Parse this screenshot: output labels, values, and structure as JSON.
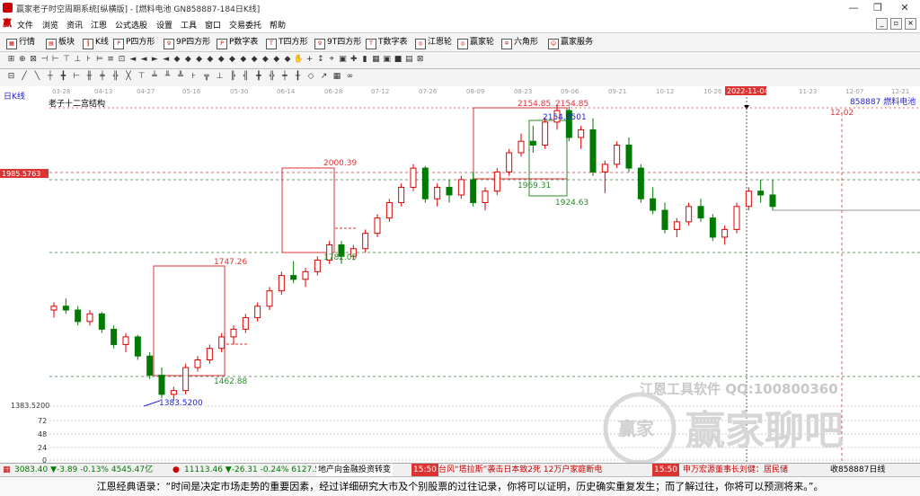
{
  "window": {
    "title": "赢家老子时空周期系统[纵横版] - [燃料电池  GN858887-184日K线]",
    "controls": [
      "—",
      "❐",
      "✕"
    ]
  },
  "menu": {
    "items": [
      "文件",
      "浏览",
      "资讯",
      "江恩",
      "公式选股",
      "设置",
      "工具",
      "窗口",
      "交易委托",
      "帮助"
    ],
    "mdi_controls": [
      "_",
      "▫",
      "×"
    ]
  },
  "toolbar_main": {
    "items": [
      {
        "label": "行情",
        "icon": "grid-icon"
      },
      {
        "label": "板块",
        "icon": "blocks-icon"
      },
      {
        "label": "K线",
        "icon": "kline-icon"
      },
      {
        "label": "P四方形",
        "icon": "square-icon"
      },
      {
        "label": "9P四方形",
        "icon": "square-icon"
      },
      {
        "label": "P数字表",
        "icon": "table-icon"
      },
      {
        "label": "T四方形",
        "icon": "square-icon"
      },
      {
        "label": "9T四方形",
        "icon": "square-icon"
      },
      {
        "label": "T数字表",
        "icon": "table-icon"
      },
      {
        "label": "江恩轮",
        "icon": "wheel-icon"
      },
      {
        "label": "赢家轮",
        "icon": "wheel-icon"
      },
      {
        "label": "六角形",
        "icon": "hexagon-icon"
      },
      {
        "label": "赢家服务",
        "icon": "service-icon"
      }
    ]
  },
  "chart": {
    "period_label": "日K线",
    "indicator_title": "老子十二宫结构",
    "stock_label": "858887 燃料电池",
    "highlight_date": "2022-11-04",
    "date_ticks": [
      "03-28",
      "04-13",
      "04-27",
      "05-16",
      "05-30",
      "06-14",
      "06-28",
      "07-12",
      "07-26",
      "08-09",
      "08-23",
      "09-06",
      "09-21",
      "10-12",
      "10-26",
      "2022-11-04",
      "11-23",
      "12-07",
      "12-21"
    ],
    "future_label": "12-02",
    "price_ticks": [
      "1383.5200",
      "72",
      "48",
      "24",
      "0"
    ],
    "left_price_box": "1985.5763",
    "annotations": {
      "peak_a": "2154.85",
      "peak_b": "2154.85",
      "blue_label": "2154.8501",
      "box3_bottom": "1969.31",
      "low_mid": "1924.63",
      "box2_top": "2000.39",
      "box2_bottom": "1782.05",
      "box1_top": "1747.26",
      "box1_bottom": "1462.88",
      "low_label": "1383.5200"
    },
    "watermark_line": "江恩工具软件  QQ:100800360",
    "watermark_logo": "赢家聊吧",
    "watermark_badge": "赢家"
  },
  "chart_data": {
    "type": "candlestick",
    "title": "",
    "ohlc": [
      [
        1620,
        1640,
        1600,
        1630
      ],
      [
        1630,
        1650,
        1610,
        1620
      ],
      [
        1620,
        1630,
        1580,
        1590
      ],
      [
        1590,
        1620,
        1580,
        1610
      ],
      [
        1610,
        1615,
        1560,
        1570
      ],
      [
        1570,
        1580,
        1520,
        1530
      ],
      [
        1530,
        1560,
        1510,
        1550
      ],
      [
        1550,
        1555,
        1490,
        1500
      ],
      [
        1500,
        1510,
        1440,
        1450
      ],
      [
        1450,
        1470,
        1390,
        1400
      ],
      [
        1400,
        1420,
        1383.52,
        1410
      ],
      [
        1410,
        1480,
        1400,
        1470
      ],
      [
        1470,
        1500,
        1460,
        1490
      ],
      [
        1490,
        1530,
        1480,
        1520
      ],
      [
        1520,
        1560,
        1510,
        1550
      ],
      [
        1550,
        1580,
        1530,
        1570
      ],
      [
        1570,
        1610,
        1560,
        1600
      ],
      [
        1600,
        1640,
        1590,
        1630
      ],
      [
        1630,
        1680,
        1620,
        1670
      ],
      [
        1670,
        1720,
        1660,
        1710
      ],
      [
        1710,
        1747.26,
        1690,
        1700
      ],
      [
        1700,
        1730,
        1680,
        1720
      ],
      [
        1720,
        1760,
        1710,
        1750
      ],
      [
        1750,
        1800,
        1740,
        1790
      ],
      [
        1790,
        1800,
        1740,
        1760
      ],
      [
        1760,
        1790,
        1750,
        1780
      ],
      [
        1780,
        1830,
        1770,
        1820
      ],
      [
        1820,
        1870,
        1810,
        1860
      ],
      [
        1860,
        1910,
        1850,
        1900
      ],
      [
        1900,
        1950,
        1890,
        1940
      ],
      [
        1940,
        2000.39,
        1930,
        1990
      ],
      [
        1990,
        1995,
        1900,
        1910
      ],
      [
        1910,
        1950,
        1890,
        1940
      ],
      [
        1940,
        1960,
        1900,
        1920
      ],
      [
        1920,
        1970,
        1910,
        1960
      ],
      [
        1960,
        1980,
        1890,
        1900
      ],
      [
        1900,
        1940,
        1880,
        1930
      ],
      [
        1930,
        1990,
        1920,
        1980
      ],
      [
        1980,
        2040,
        1970,
        2030
      ],
      [
        2030,
        2080,
        2020,
        2060
      ],
      [
        2060,
        2100,
        2030,
        2050
      ],
      [
        2050,
        2120,
        2040,
        2110
      ],
      [
        2110,
        2154.85,
        2090,
        2140
      ],
      [
        2140,
        2150,
        2060,
        2070
      ],
      [
        2070,
        2100,
        2040,
        2090
      ],
      [
        2090,
        2120,
        1969.31,
        1980
      ],
      [
        1980,
        2010,
        1924.63,
        2000
      ],
      [
        2000,
        2060,
        1990,
        2050
      ],
      [
        2050,
        2070,
        1980,
        1990
      ],
      [
        1990,
        2000,
        1900,
        1910
      ],
      [
        1910,
        1940,
        1870,
        1880
      ],
      [
        1880,
        1900,
        1820,
        1830
      ],
      [
        1830,
        1860,
        1810,
        1850
      ],
      [
        1850,
        1900,
        1840,
        1890
      ],
      [
        1890,
        1910,
        1850,
        1860
      ],
      [
        1860,
        1870,
        1800,
        1810
      ],
      [
        1810,
        1840,
        1790,
        1830
      ],
      [
        1830,
        1900,
        1820,
        1890
      ],
      [
        1890,
        1940,
        1880,
        1930
      ],
      [
        1930,
        1960,
        1900,
        1920
      ],
      [
        1920,
        1960,
        1880,
        1890
      ]
    ],
    "ylim": [
      1360,
      2180
    ],
    "xlabel": "",
    "ylabel": ""
  },
  "status": {
    "index1": "3083.40 ▼-3.89 -0.13% 4545.47亿",
    "index2": "11113.46 ▼-26.31 -0.24% 6127.5",
    "news1": "地产向金融投资转变",
    "time1": "15:50",
    "news2": "台风“塔拉斯”袭击日本致2死 12万户家庭断电",
    "time2": "15:50",
    "news3": "申万宏源董事长刘健：居民储",
    "right": "收858887日线"
  },
  "quote": {
    "text": "江恩经典语录：“时间是决定市场走势的重要因素，经过详细研究大市及个别股票的过往记录，你将可以证明，历史确实重复发生；而了解过往，你将可以预测将来。”。"
  },
  "colors": {
    "up": "#e00000",
    "down": "#007a00",
    "box_red": "#d33",
    "box_green": "#2a8a2a",
    "blue": "#2222cc"
  }
}
